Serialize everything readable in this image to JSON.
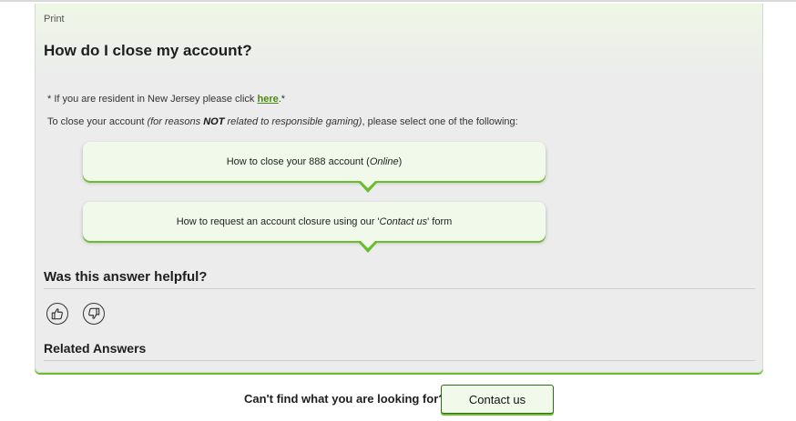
{
  "article": {
    "print_label": "Print",
    "title": "How do I close my account?",
    "nj_notice_prefix": "* If you are resident in New Jersey please click ",
    "nj_link": "here",
    "nj_notice_suffix": ".*",
    "intro_start": "To close your account ",
    "intro_italic_start": "(for reasons ",
    "intro_bold": "NOT",
    "intro_italic_end": " related to responsible gaming)",
    "intro_end": ", please select one of the following:"
  },
  "options": [
    {
      "label_start": "How to close your 888 account (",
      "label_italic": "Online",
      "label_end": ")"
    },
    {
      "label_start": "How to request an account closure using our '",
      "label_italic": "Contact us",
      "label_end": "' form"
    }
  ],
  "feedback": {
    "heading": "Was this answer helpful?",
    "thumbs_up_icon": "thumbs-up-icon",
    "thumbs_down_icon": "thumbs-down-icon"
  },
  "related": {
    "heading": "Related Answers"
  },
  "footer": {
    "text": "Can't find what you are looking for?",
    "contact_label": "Contact us"
  },
  "colors": {
    "accent": "#6bbd2e",
    "link": "#4a8a12",
    "option_bg": "#f1faea",
    "card_bg": "#ececec"
  }
}
